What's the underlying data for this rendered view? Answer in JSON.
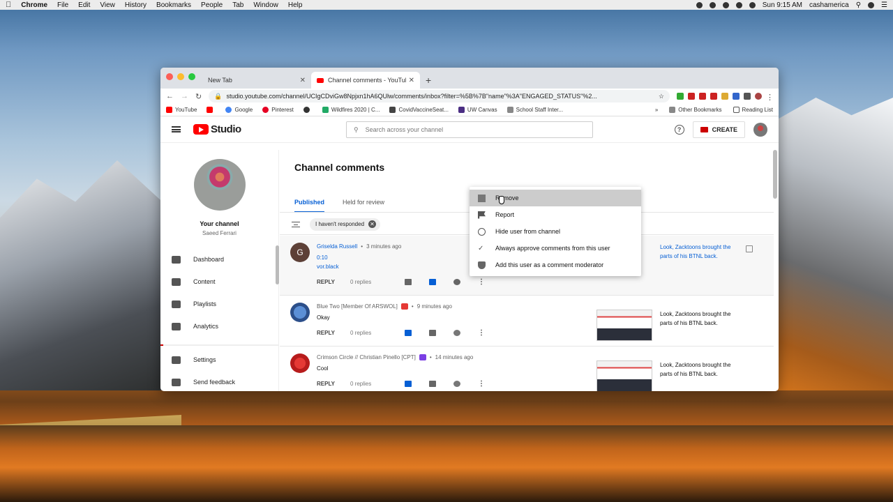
{
  "menubar": {
    "app": "Chrome",
    "items": [
      "File",
      "Edit",
      "View",
      "History",
      "Bookmarks",
      "People",
      "Tab",
      "Window",
      "Help"
    ],
    "clock": "Sun 9:15 AM",
    "user": "cashamerica"
  },
  "browser": {
    "tabs": [
      {
        "title": "New Tab"
      },
      {
        "title": "Channel comments - YouTube"
      }
    ],
    "url": "studio.youtube.com/channel/UCIgCDviGw8Npjxn1hA6QUlw/comments/inbox?filter=%5B%7B\"name\"%3A\"ENGAGED_STATUS\"%2...",
    "bookmarks": [
      "YouTube",
      "",
      "Google",
      "Pinterest",
      "",
      "Wildfires 2020 | C...",
      "CovidVaccineSeat...",
      "UW Canvas",
      "School Staff Inter..."
    ],
    "bookmarks_right": [
      "»",
      "Other Bookmarks",
      "Reading List"
    ]
  },
  "studio": {
    "logo_text": "Studio",
    "search_placeholder": "Search across your channel",
    "create_label": "CREATE",
    "help_glyph": "?"
  },
  "sidebar": {
    "channel_title": "Your channel",
    "channel_name": "Saeed Ferrari",
    "items": [
      {
        "label": "Dashboard"
      },
      {
        "label": "Content"
      },
      {
        "label": "Playlists"
      },
      {
        "label": "Analytics"
      },
      {
        "label": "Settings"
      },
      {
        "label": "Send feedback"
      }
    ]
  },
  "main": {
    "title": "Channel comments",
    "tabs": [
      {
        "label": "Published"
      },
      {
        "label": "Held for review"
      }
    ],
    "filter_chip": "I haven't responded",
    "comments": [
      {
        "avatar": "G",
        "author": "Griselda Russell",
        "time": "3 minutes ago",
        "line1": "0:10",
        "line2": "vor.black",
        "reply": "REPLY",
        "replies": "0 replies",
        "video": "Look, Zacktoons brought the parts of his BTNL back."
      },
      {
        "author": "Blue Two [Member Of ARSWOL]",
        "time": "9 minutes ago",
        "text": "Okay",
        "reply": "REPLY",
        "replies": "0 replies",
        "video": "Look, Zacktoons brought the parts of his BTNL back."
      },
      {
        "author": "Crimson Circle // Christian Pinello [CPT]",
        "time": "14 minutes ago",
        "text": "Cool",
        "reply": "REPLY",
        "replies": "0 replies",
        "video": "Look, Zacktoons brought the parts of his BTNL back."
      }
    ]
  },
  "context_menu": {
    "items": [
      {
        "label": "Remove",
        "icon": "trash-icon"
      },
      {
        "label": "Report",
        "icon": "flag-icon"
      },
      {
        "label": "Hide user from channel",
        "icon": "block-icon"
      },
      {
        "label": "Always approve comments from this user",
        "icon": "check-double-icon"
      },
      {
        "label": "Add this user as a comment moderator",
        "icon": "shield-add-icon"
      }
    ]
  },
  "colors": {
    "accent": "#065fd4",
    "brand": "#ff0000"
  }
}
